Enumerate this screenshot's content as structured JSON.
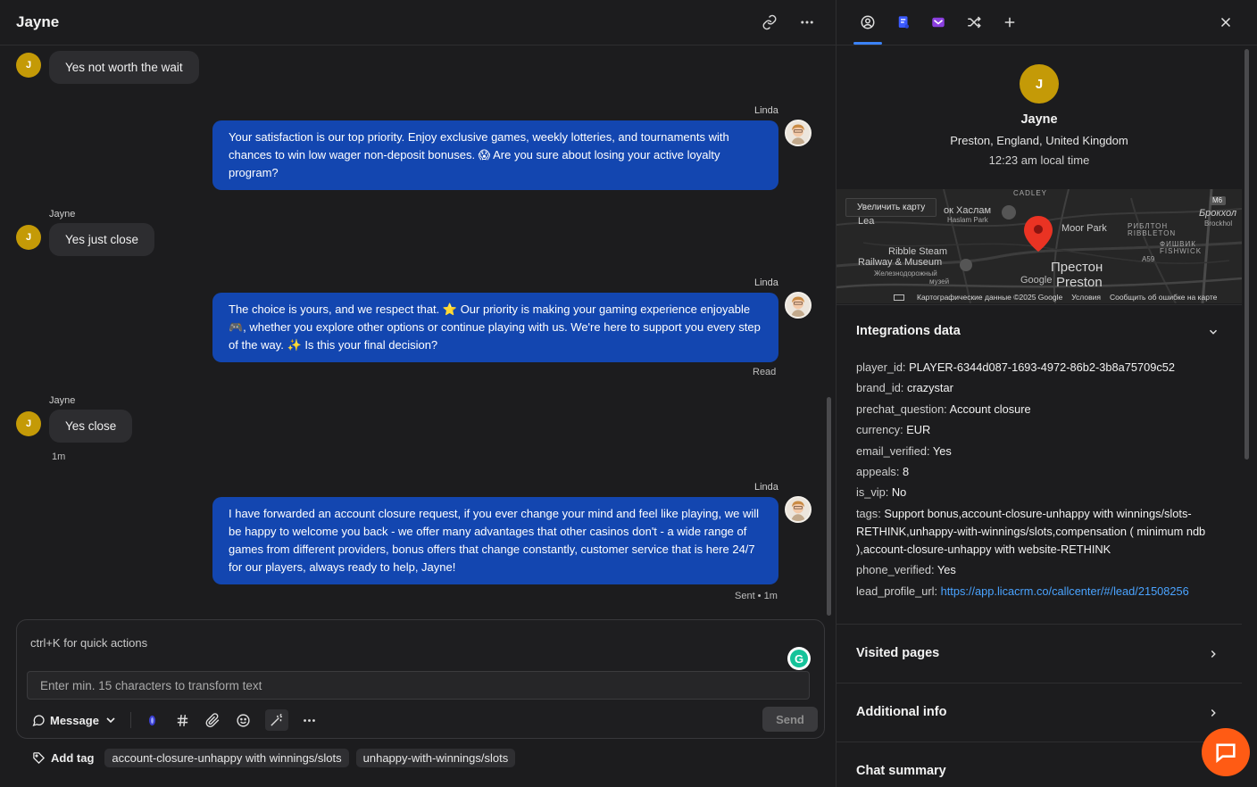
{
  "chat": {
    "title": "Jayne",
    "messages": [
      {
        "type": "in",
        "text": "Yes not worth the wait",
        "avatar": "J"
      },
      {
        "type": "out",
        "sender": "Linda",
        "text": "Your satisfaction is our top priority. Enjoy exclusive games, weekly lotteries, and tournaments with chances to win low wager non-deposit bonuses. 😱 Are you sure about losing your active loyalty program?"
      },
      {
        "type": "in",
        "sender": "Jayne",
        "text": "Yes just close",
        "avatar": "J"
      },
      {
        "type": "out",
        "sender": "Linda",
        "text": "The choice is yours, and we respect that. ⭐ Our priority is making your gaming experience enjoyable 🎮, whether you explore other options or continue playing with us. We're here to support you every step of the way. ✨ Is this your final decision?",
        "status": "Read"
      },
      {
        "type": "in",
        "sender": "Jayne",
        "text": "Yes close",
        "avatar": "J",
        "time": "1m"
      },
      {
        "type": "out",
        "sender": "Linda",
        "text": "I have forwarded an account closure request, if you ever change your mind and feel like playing, we will be happy to welcome you back - we offer many advantages that other casinos don't - a wide range of games from different providers, bonus offers that change constantly, customer service that is here 24/7 for our players, always ready to help, Jayne!",
        "status": "Sent • 1m"
      }
    ]
  },
  "composer": {
    "placeholder": "ctrl+K for quick actions",
    "transform_placeholder": "Enter min. 15 characters to transform text",
    "message_type": "Message",
    "send_label": "Send",
    "grammarly": "G"
  },
  "tags": {
    "add_label": "Add tag",
    "items": [
      "account-closure-unhappy with winnings/slots",
      "unhappy-with-winnings/slots"
    ]
  },
  "profile": {
    "avatar": "J",
    "name": "Jayne",
    "location": "Preston, England, United Kingdom",
    "local_time": "12:23 am local time"
  },
  "map": {
    "enlarge_label": "Увеличить карту",
    "labels": {
      "cadley": "CADLEY",
      "haslam": "ок Хаслам",
      "haslam_en": "Haslam Park",
      "lea": "Lea",
      "moor_park": "Moor Park",
      "ribbleton": "РИБЛТОН\nRIBBLETON",
      "fishwick": "ФИШВИК\nFISHWICK",
      "brockholes": "Брокхол",
      "brockholes_en": "Brockhol",
      "ribble_steam": "Ribble Steam",
      "railway_museum": "Railway & Museum",
      "railway_ru": "Железнодорожный",
      "museum_ru": "музей",
      "preston_ru": "Престон",
      "preston": "Preston",
      "google": "Google",
      "a59": "A59",
      "m6": "M6"
    },
    "footer": {
      "data": "Картографические данные ©2025 Google",
      "terms": "Условия",
      "report": "Сообщить об ошибке на карте"
    }
  },
  "integrations": {
    "title": "Integrations data",
    "rows": [
      {
        "key": "player_id:",
        "value": "PLAYER-6344d087-1693-4972-86b2-3b8a75709c52"
      },
      {
        "key": "brand_id:",
        "value": "crazystar"
      },
      {
        "key": "prechat_question:",
        "value": "Account closure"
      },
      {
        "key": "currency:",
        "value": "EUR"
      },
      {
        "key": "email_verified:",
        "value": "Yes"
      },
      {
        "key": "appeals:",
        "value": "8"
      },
      {
        "key": "is_vip:",
        "value": "No"
      },
      {
        "key": "tags:",
        "value": "Support bonus,account-closure-unhappy with winnings/slots-RETHINK,unhappy-with-winnings/slots,compensation ( minimum ndb ),account-closure-unhappy with website-RETHINK"
      },
      {
        "key": "phone_verified:",
        "value": "Yes"
      },
      {
        "key": "lead_profile_url:",
        "value": "https://app.licacrm.co/callcenter/#/lead/21508256",
        "link": true
      }
    ]
  },
  "sections": {
    "visited": "Visited pages",
    "additional": "Additional info",
    "summary": "Chat summary"
  },
  "colors": {
    "accent_blue": "#1346b0",
    "avatar_gold": "#c49a07",
    "help_orange": "#ff5b14",
    "link_blue": "#4aa3ff"
  }
}
